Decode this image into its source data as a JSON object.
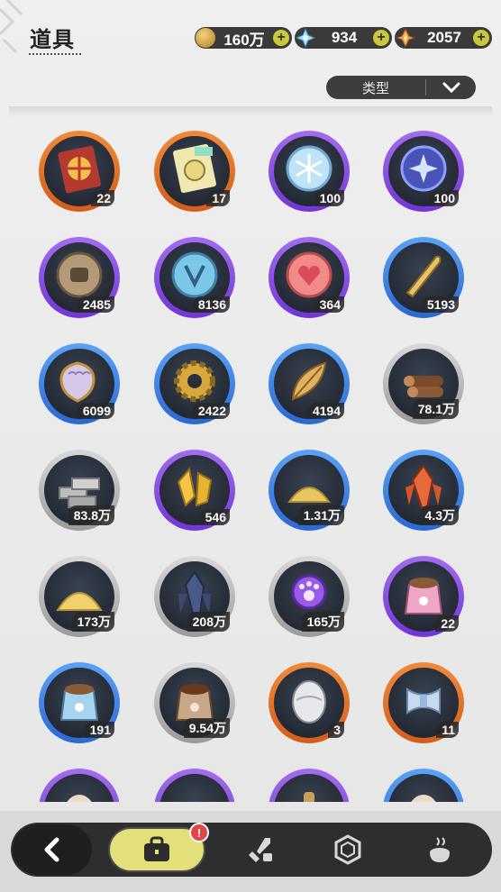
{
  "header": {
    "title": "道具"
  },
  "currencies": [
    {
      "icon": "gold-coin-icon",
      "amount": "160万",
      "color": "#caa04a"
    },
    {
      "icon": "snow-crystal-icon",
      "amount": "934",
      "color": "#8fd2f0"
    },
    {
      "icon": "star-gem-icon",
      "amount": "2057",
      "color": "#e08a3c"
    }
  ],
  "filter": {
    "label": "类型"
  },
  "items": [
    {
      "name": "spin-ticket",
      "count": "22",
      "rarity": "orange"
    },
    {
      "name": "coin-ticket",
      "count": "17",
      "rarity": "orange"
    },
    {
      "name": "snowflake-coin",
      "count": "100",
      "rarity": "purple"
    },
    {
      "name": "star-coin",
      "count": "100",
      "rarity": "purple"
    },
    {
      "name": "fist-medal",
      "count": "2485",
      "rarity": "purple"
    },
    {
      "name": "emblem-medal",
      "count": "8136",
      "rarity": "purple"
    },
    {
      "name": "heart-medal",
      "count": "364",
      "rarity": "purple"
    },
    {
      "name": "golden-blade",
      "count": "5193",
      "rarity": "blue"
    },
    {
      "name": "scale-shield",
      "count": "6099",
      "rarity": "blue"
    },
    {
      "name": "gear",
      "count": "2422",
      "rarity": "blue"
    },
    {
      "name": "golden-leaf",
      "count": "4194",
      "rarity": "blue"
    },
    {
      "name": "wood-logs",
      "count": "78.1万",
      "rarity": "gray"
    },
    {
      "name": "stone-bricks",
      "count": "83.8万",
      "rarity": "gray"
    },
    {
      "name": "gold-crystal",
      "count": "546",
      "rarity": "purple"
    },
    {
      "name": "gold-sand",
      "count": "1.31万",
      "rarity": "blue"
    },
    {
      "name": "red-crystal",
      "count": "4.3万",
      "rarity": "blue"
    },
    {
      "name": "sand-pile",
      "count": "173万",
      "rarity": "gray"
    },
    {
      "name": "dark-crystal",
      "count": "208万",
      "rarity": "gray"
    },
    {
      "name": "paw-orb",
      "count": "165万",
      "rarity": "gray"
    },
    {
      "name": "pink-food-bag",
      "count": "22",
      "rarity": "purple"
    },
    {
      "name": "blue-food-bag",
      "count": "191",
      "rarity": "blue"
    },
    {
      "name": "brown-food-bag",
      "count": "9.54万",
      "rarity": "gray"
    },
    {
      "name": "egg",
      "count": "3",
      "rarity": "orange"
    },
    {
      "name": "scroll",
      "count": "11",
      "rarity": "orange"
    },
    {
      "name": "egg-partial",
      "count": "",
      "rarity": "purple"
    },
    {
      "name": "item-partial",
      "count": "",
      "rarity": "purple"
    },
    {
      "name": "bottle-partial",
      "count": "",
      "rarity": "purple"
    },
    {
      "name": "egg-partial-2",
      "count": "",
      "rarity": "blue"
    }
  ],
  "nav": {
    "tabs": [
      {
        "name": "bag",
        "icon": "bag-icon",
        "active": true
      },
      {
        "name": "equipment",
        "icon": "sword-boot-icon",
        "active": false
      },
      {
        "name": "gems",
        "icon": "hexagon-gem-icon",
        "active": false
      },
      {
        "name": "cooking",
        "icon": "pot-icon",
        "active": false
      }
    ],
    "badge": "!"
  }
}
